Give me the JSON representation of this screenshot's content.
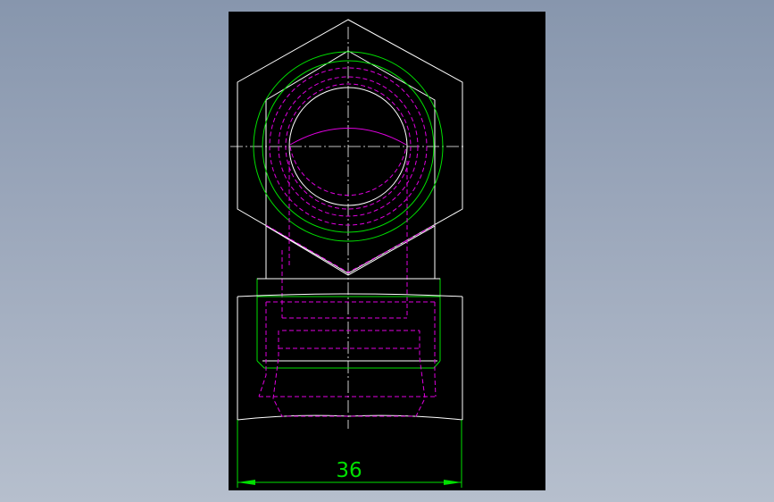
{
  "drawing": {
    "background": "#000000",
    "colors": {
      "outline": "#ffffff",
      "dimension": "#00e000",
      "hidden_lines": "#e000e0"
    },
    "dimension": {
      "label": "36"
    }
  }
}
